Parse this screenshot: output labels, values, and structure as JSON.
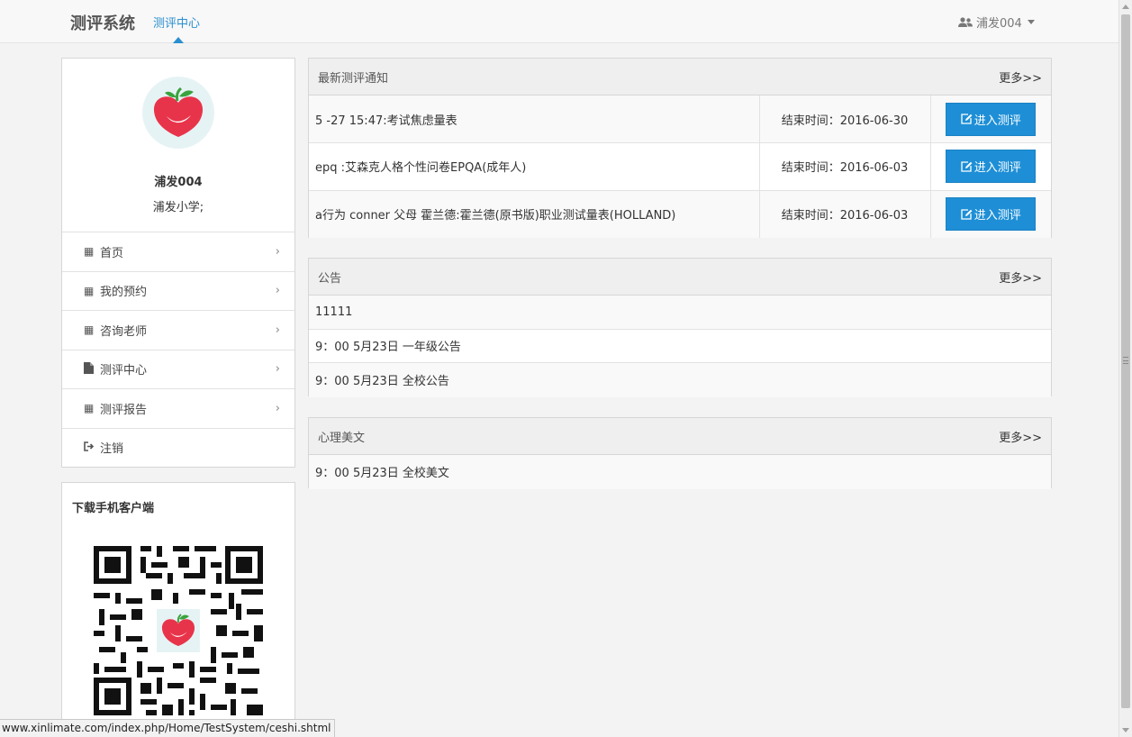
{
  "navbar": {
    "brand": "测评系统",
    "active_link": "测评中心",
    "user": "浦发004"
  },
  "profile": {
    "name": "浦发004",
    "school": "浦发小学;"
  },
  "menu": [
    {
      "label": "首页",
      "icon": "table-icon"
    },
    {
      "label": "我的预约",
      "icon": "table-icon"
    },
    {
      "label": "咨询老师",
      "icon": "table-icon"
    },
    {
      "label": "测评中心",
      "icon": "file-icon"
    },
    {
      "label": "测评报告",
      "icon": "table-icon"
    },
    {
      "label": "注销",
      "icon": "sign-out-icon"
    }
  ],
  "qr": {
    "title": "下载手机客户端"
  },
  "notices": {
    "title": "最新测评通知",
    "more": "更多>>",
    "rows": [
      {
        "title": "5 -27 15:47:考试焦虑量表",
        "end": "结束时间：2016-06-30",
        "button": "进入测评"
      },
      {
        "title": "epq :艾森克人格个性问卷EPQA(成年人)",
        "end": "结束时间：2016-06-03",
        "button": "进入测评"
      },
      {
        "title": "a行为 conner 父母 霍兰德:霍兰德(原书版)职业测试量表(HOLLAND)",
        "end": "结束时间：2016-06-03",
        "button": "进入测评"
      }
    ]
  },
  "announcements": {
    "title": "公告",
    "more": "更多>>",
    "items": [
      "11111",
      "9：00 5月23日 一年级公告",
      "9：00 5月23日 全校公告"
    ]
  },
  "articles": {
    "title": "心理美文",
    "more": "更多>>",
    "items": [
      "9：00 5月23日 全校美文"
    ]
  },
  "status_url": "www.xinlimate.com/index.php/Home/TestSystem/ceshi.shtml",
  "colors": {
    "accent": "#1e8fd6",
    "link": "#2a8fd0"
  }
}
